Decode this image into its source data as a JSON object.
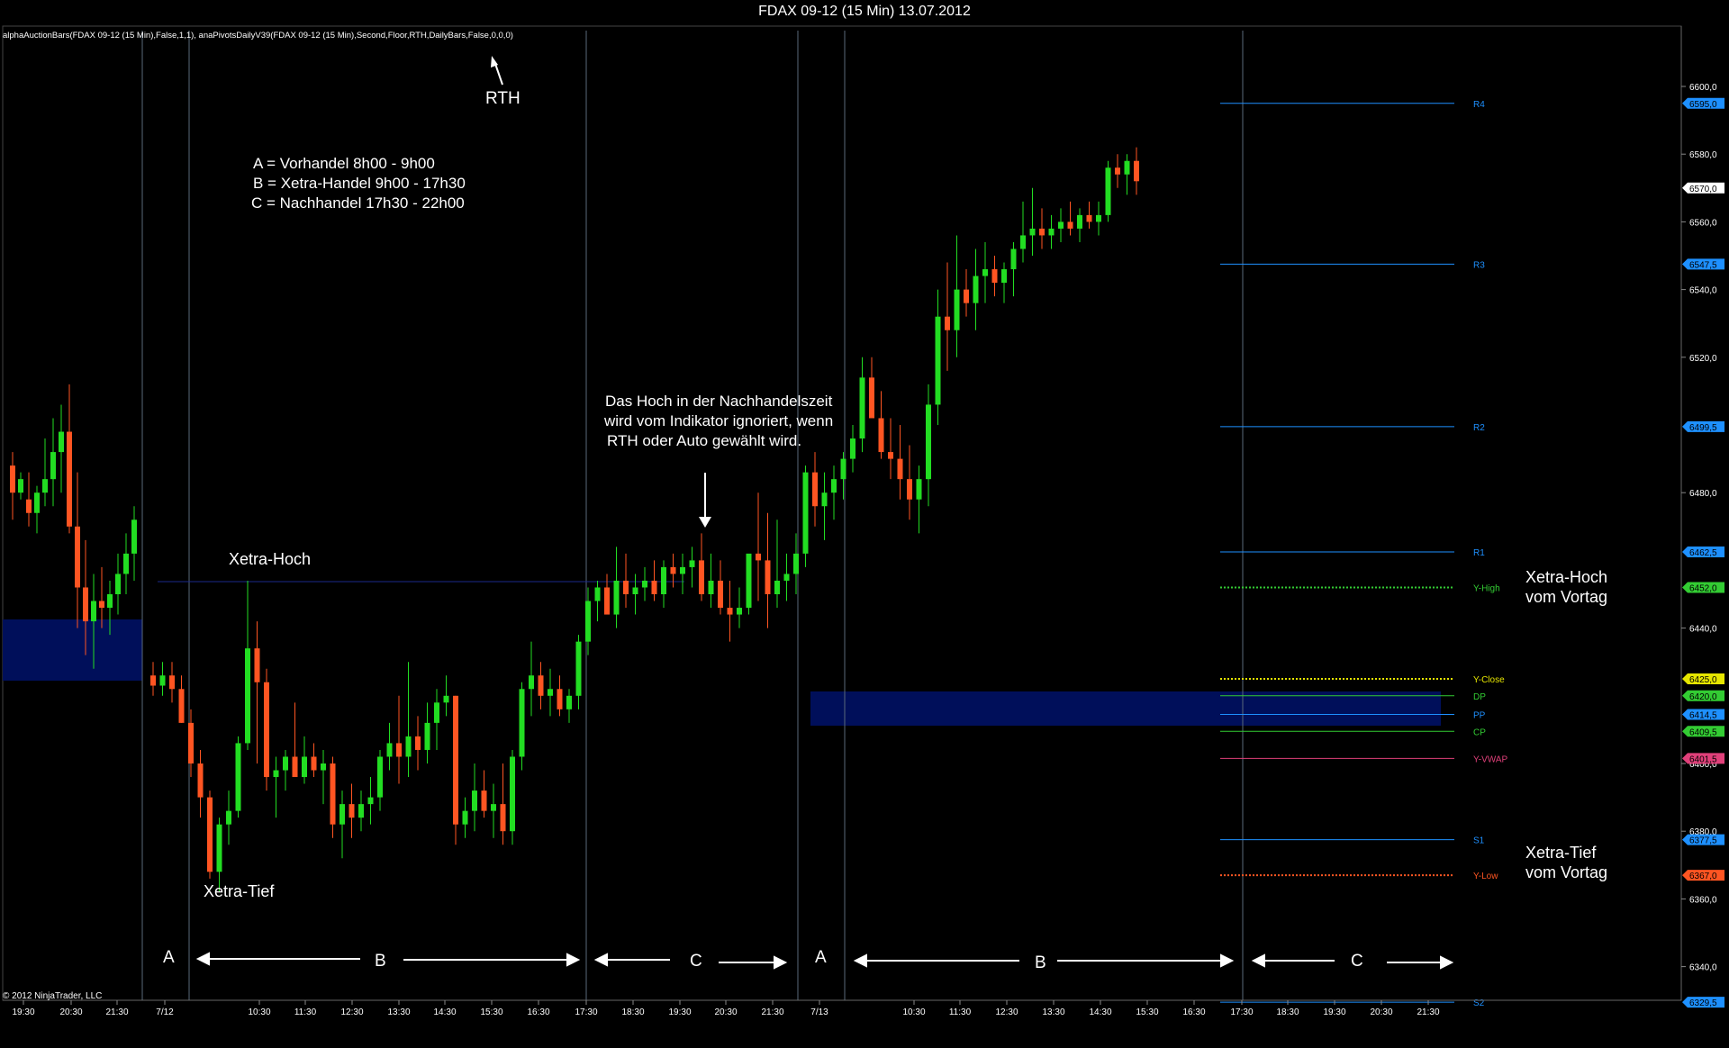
{
  "window": {
    "title": "FDAX 09-12 (15 Min)  13.07.2012"
  },
  "indicator_line": "alphaAuctionBars(FDAX 09-12 (15 Min),False,1,1), anaPivotsDailyV39(FDAX 09-12 (15 Min),Second,Floor,RTH,DailyBars,False,0,0,0)",
  "copyright": "© 2012 NinjaTrader, LLC",
  "annotations": {
    "rth": "RTH",
    "legend_a": "A = Vorhandel 8h00 - 9h00",
    "legend_b": "B = Xetra-Handel 9h00 - 17h30",
    "legend_c": "C = Nachhandel 17h30 - 22h00",
    "note_line1": "Das Hoch in der Nachhandelszeit",
    "note_line2": "wird vom Indikator ignoriert, wenn",
    "note_line3": "RTH oder Auto gewählt wird.",
    "xetra_hoch": "Xetra-Hoch",
    "xetra_tief": "Xetra-Tief",
    "xetra_hoch_vortag_1": "Xetra-Hoch",
    "xetra_hoch_vortag_2": "vom Vortag",
    "xetra_tief_vortag_1": "Xetra-Tief",
    "xetra_tief_vortag_2": "vom Vortag",
    "session_a": "A",
    "session_b": "B",
    "session_c": "C"
  },
  "x_axis_labels": [
    "19:30",
    "20:30",
    "21:30",
    "7/12",
    "10:30",
    "11:30",
    "12:30",
    "13:30",
    "14:30",
    "15:30",
    "16:30",
    "17:30",
    "18:30",
    "19:30",
    "20:30",
    "21:30",
    "7/13",
    "10:30",
    "11:30",
    "12:30",
    "13:30",
    "14:30",
    "15:30",
    "16:30",
    "17:30",
    "18:30",
    "19:30",
    "20:30",
    "21:30"
  ],
  "y_axis_labels": [
    "6600,0",
    "6580,0",
    "6560,0",
    "6540,0",
    "6520,0",
    "6480,0",
    "6440,0",
    "6400,0",
    "6380,0",
    "6360,0",
    "6340,0"
  ],
  "price_tags": [
    {
      "label": "R4",
      "value": "6595,0",
      "color": "#1e90ff"
    },
    {
      "label": "",
      "value": "6570,0",
      "color": "#ffffff"
    },
    {
      "label": "R3",
      "value": "6547,5",
      "color": "#1e90ff"
    },
    {
      "label": "R2",
      "value": "6499,5",
      "color": "#1e90ff"
    },
    {
      "label": "R1",
      "value": "6462,5",
      "color": "#1e90ff"
    },
    {
      "label": "Y-High",
      "value": "6452,0",
      "color": "#33cc33"
    },
    {
      "label": "Y-Close",
      "value": "6425,0",
      "color": "#e6e600"
    },
    {
      "label": "DP",
      "value": "6420,0",
      "color": "#33cc33"
    },
    {
      "label": "PP",
      "value": "6414,5",
      "color": "#1e90ff"
    },
    {
      "label": "CP",
      "value": "6409,5",
      "color": "#33cc33"
    },
    {
      "label": "Y-VWAP",
      "value": "6401,5",
      "color": "#e0407a"
    },
    {
      "label": "S1",
      "value": "6377,5",
      "color": "#1e90ff"
    },
    {
      "label": "Y-Low",
      "value": "6367,0",
      "color": "#ff5522"
    },
    {
      "label": "S2",
      "value": "6329,5",
      "color": "#1e90ff"
    }
  ],
  "colors": {
    "up": "#22dd22",
    "down": "#ff5522",
    "doji_up": "#ffffff",
    "value_area": "#000f5a",
    "pivot_blue": "#1e90ff",
    "session_line": "#5a6a7a"
  },
  "chart_data": {
    "type": "candlestick",
    "ylim": [
      6325,
      6620
    ],
    "candles": [
      [
        6488,
        6492,
        6472,
        6480
      ],
      [
        6480,
        6486,
        6478,
        6484
      ],
      [
        6478,
        6486,
        6470,
        6474
      ],
      [
        6474,
        6482,
        6468,
        6480
      ],
      [
        6480,
        6496,
        6476,
        6484
      ],
      [
        6484,
        6502,
        6476,
        6492
      ],
      [
        6492,
        6506,
        6480,
        6498
      ],
      [
        6498,
        6512,
        6468,
        6470
      ],
      [
        6470,
        6486,
        6440,
        6452
      ],
      [
        6452,
        6466,
        6432,
        6442
      ],
      [
        6442,
        6456,
        6428,
        6448
      ],
      [
        6448,
        6458,
        6440,
        6446
      ],
      [
        6446,
        6454,
        6438,
        6450
      ],
      [
        6450,
        6462,
        6444,
        6456
      ],
      [
        6456,
        6468,
        6450,
        6462
      ],
      [
        6462,
        6476,
        6454,
        6472
      ],
      [
        6426,
        6430,
        6420,
        6423
      ],
      [
        6423,
        6430,
        6420,
        6426
      ],
      [
        6426,
        6430,
        6418,
        6422
      ],
      [
        6422,
        6426,
        6412,
        6412
      ],
      [
        6412,
        6416,
        6396,
        6400
      ],
      [
        6400,
        6404,
        6384,
        6390
      ],
      [
        6390,
        6392,
        6366,
        6368
      ],
      [
        6368,
        6384,
        6362,
        6382
      ],
      [
        6382,
        6392,
        6376,
        6386
      ],
      [
        6386,
        6408,
        6384,
        6406
      ],
      [
        6406,
        6454,
        6404,
        6434
      ],
      [
        6434,
        6442,
        6400,
        6424
      ],
      [
        6424,
        6428,
        6392,
        6396
      ],
      [
        6396,
        6402,
        6384,
        6398
      ],
      [
        6398,
        6404,
        6392,
        6402
      ],
      [
        6402,
        6418,
        6398,
        6396
      ],
      [
        6396,
        6408,
        6394,
        6402
      ],
      [
        6402,
        6406,
        6396,
        6398
      ],
      [
        6398,
        6404,
        6388,
        6400
      ],
      [
        6400,
        6402,
        6378,
        6382
      ],
      [
        6382,
        6392,
        6372,
        6388
      ],
      [
        6388,
        6394,
        6378,
        6384
      ],
      [
        6384,
        6392,
        6380,
        6388
      ],
      [
        6388,
        6396,
        6382,
        6390
      ],
      [
        6390,
        6404,
        6386,
        6402
      ],
      [
        6402,
        6412,
        6398,
        6406
      ],
      [
        6406,
        6420,
        6394,
        6402
      ],
      [
        6402,
        6430,
        6396,
        6408
      ],
      [
        6408,
        6414,
        6398,
        6404
      ],
      [
        6404,
        6418,
        6400,
        6412
      ],
      [
        6412,
        6422,
        6404,
        6418
      ],
      [
        6418,
        6426,
        6414,
        6420
      ],
      [
        6420,
        6420,
        6376,
        6382
      ],
      [
        6382,
        6390,
        6378,
        6386
      ],
      [
        6386,
        6400,
        6380,
        6392
      ],
      [
        6392,
        6398,
        6384,
        6386
      ],
      [
        6386,
        6394,
        6378,
        6388
      ],
      [
        6388,
        6400,
        6376,
        6380
      ],
      [
        6380,
        6404,
        6376,
        6402
      ],
      [
        6402,
        6424,
        6398,
        6422
      ],
      [
        6422,
        6436,
        6414,
        6426
      ],
      [
        6426,
        6430,
        6416,
        6420
      ],
      [
        6420,
        6428,
        6414,
        6422
      ],
      [
        6422,
        6426,
        6414,
        6416
      ],
      [
        6416,
        6422,
        6412,
        6420
      ],
      [
        6420,
        6438,
        6416,
        6436
      ],
      [
        6436,
        6452,
        6432,
        6448
      ],
      [
        6448,
        6454,
        6442,
        6452
      ],
      [
        6452,
        6456,
        6446,
        6444
      ],
      [
        6444,
        6464,
        6440,
        6454
      ],
      [
        6454,
        6462,
        6446,
        6450
      ],
      [
        6450,
        6456,
        6444,
        6452
      ],
      [
        6452,
        6458,
        6448,
        6454
      ],
      [
        6454,
        6460,
        6448,
        6450
      ],
      [
        6450,
        6460,
        6446,
        6458
      ],
      [
        6458,
        6462,
        6452,
        6456
      ],
      [
        6456,
        6462,
        6450,
        6458
      ],
      [
        6458,
        6464,
        6452,
        6460
      ],
      [
        6460,
        6468,
        6448,
        6450
      ],
      [
        6450,
        6462,
        6446,
        6454
      ],
      [
        6454,
        6460,
        6444,
        6446
      ],
      [
        6446,
        6454,
        6436,
        6444
      ],
      [
        6444,
        6452,
        6440,
        6446
      ],
      [
        6446,
        6456,
        6444,
        6462
      ],
      [
        6462,
        6480,
        6448,
        6460
      ],
      [
        6460,
        6474,
        6440,
        6450
      ],
      [
        6450,
        6472,
        6446,
        6454
      ],
      [
        6454,
        6462,
        6448,
        6456
      ],
      [
        6456,
        6468,
        6450,
        6462
      ],
      [
        6462,
        6488,
        6458,
        6486
      ],
      [
        6486,
        6492,
        6470,
        6476
      ],
      [
        6476,
        6486,
        6466,
        6480
      ],
      [
        6480,
        6488,
        6472,
        6484
      ],
      [
        6484,
        6492,
        6478,
        6490
      ],
      [
        6490,
        6500,
        6486,
        6496
      ],
      [
        6496,
        6520,
        6492,
        6514
      ],
      [
        6514,
        6520,
        6506,
        6502
      ],
      [
        6502,
        6510,
        6490,
        6492
      ],
      [
        6492,
        6502,
        6484,
        6490
      ],
      [
        6490,
        6500,
        6478,
        6484
      ],
      [
        6484,
        6494,
        6472,
        6478
      ],
      [
        6478,
        6488,
        6468,
        6484
      ],
      [
        6484,
        6512,
        6476,
        6506
      ],
      [
        6506,
        6540,
        6500,
        6532
      ],
      [
        6532,
        6548,
        6516,
        6528
      ],
      [
        6528,
        6556,
        6520,
        6540
      ],
      [
        6540,
        6546,
        6532,
        6536
      ],
      [
        6536,
        6552,
        6528,
        6544
      ],
      [
        6544,
        6554,
        6536,
        6546
      ],
      [
        6546,
        6550,
        6538,
        6542
      ],
      [
        6542,
        6548,
        6536,
        6546
      ],
      [
        6546,
        6554,
        6538,
        6552
      ],
      [
        6552,
        6566,
        6548,
        6556
      ],
      [
        6556,
        6570,
        6550,
        6558
      ],
      [
        6558,
        6564,
        6552,
        6556
      ],
      [
        6556,
        6562,
        6552,
        6558
      ],
      [
        6558,
        6564,
        6554,
        6560
      ],
      [
        6560,
        6566,
        6556,
        6558
      ],
      [
        6558,
        6564,
        6554,
        6562
      ],
      [
        6562,
        6566,
        6558,
        6560
      ],
      [
        6560,
        6566,
        6556,
        6562
      ],
      [
        6562,
        6578,
        6560,
        6576
      ],
      [
        6576,
        6580,
        6570,
        6574
      ],
      [
        6574,
        6580,
        6568,
        6578
      ],
      [
        6578,
        6582,
        6568,
        6572
      ]
    ]
  }
}
